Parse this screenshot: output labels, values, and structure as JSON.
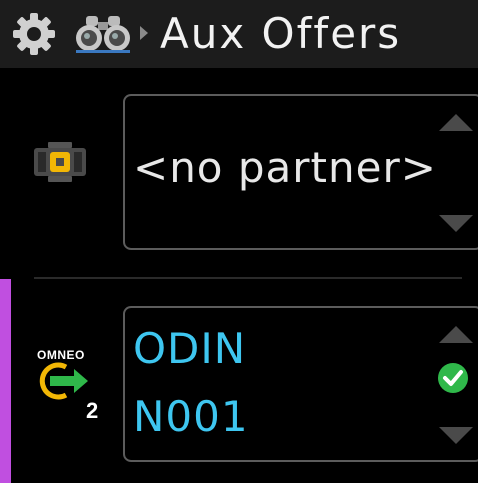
{
  "header": {
    "title": "Aux Offers",
    "icons": [
      "gear-icon",
      "binoculars-icon",
      "breadcrumb-arrow-icon"
    ]
  },
  "partner_row": {
    "device_icon": "device-connector-icon",
    "value": "<no partner>"
  },
  "subscription_row": {
    "protocol_label": "OMNEO",
    "protocol_count": "2",
    "line1": "ODIN",
    "line2": "N001",
    "status_icon": "check-circle-icon"
  },
  "colors": {
    "accent": "#c04fe0",
    "value_text": "#3ec6f0",
    "status_ok": "#2fb84a",
    "omneo_ring": "#f2b705",
    "omneo_arrow": "#2fb84a"
  }
}
